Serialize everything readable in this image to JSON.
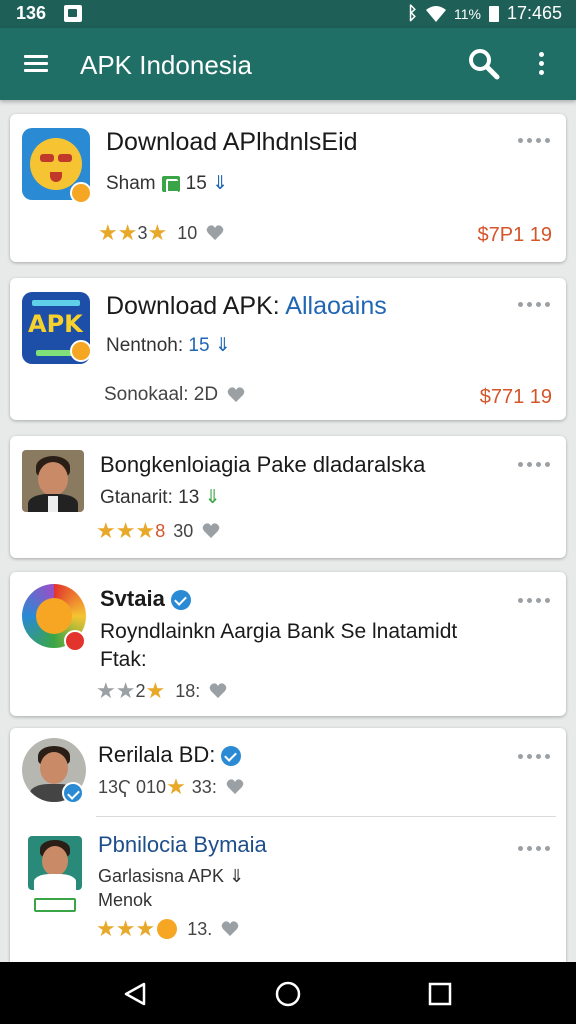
{
  "status_bar": {
    "left_time": "136",
    "battery_percent": "11%",
    "clock": "17:465"
  },
  "app_bar": {
    "title": "APK Indonesia"
  },
  "cards": [
    {
      "title": "Download APlhdnlsEid",
      "sub_text": "Sham",
      "sub_number": "15",
      "rating_text": "3",
      "rating_count": "10",
      "price": "$7P1 19"
    },
    {
      "title_a": "Download APK: ",
      "title_b": "Allaoains",
      "sub_text": "Nentnoh: ",
      "sub_number": "15",
      "meta": "Sonokaal: 2D",
      "price": "$771 19"
    },
    {
      "title": "Bongkenloiagia Pake dladaralska",
      "sub_text": "Gtanarit: 13",
      "rating_text": "8",
      "rating_count": "30"
    },
    {
      "title": "Svtaia",
      "body_line1": "Royndlainkn Aargia Bank Se lnatamidt",
      "body_line2": "Ftak:",
      "rating_text": "2",
      "rating_count": "18:"
    },
    {
      "item1_title": "Rerilala BD:",
      "item1_meta": "13Ҁ 010",
      "item1_count": "33:",
      "item2_title": "Pbnilocia Bymaia",
      "item2_sub": "Garlasisna APK",
      "item2_sub2": "Menok",
      "item2_count": "13."
    }
  ],
  "nav": {
    "back": "back-icon",
    "home": "home-icon",
    "recent": "recent-apps-icon"
  },
  "colors": {
    "app_bar": "#1f6f66",
    "status_bar": "#1e5f57",
    "price": "#d4552a",
    "star": "#e8a92a",
    "link_blue": "#1f66b3"
  }
}
